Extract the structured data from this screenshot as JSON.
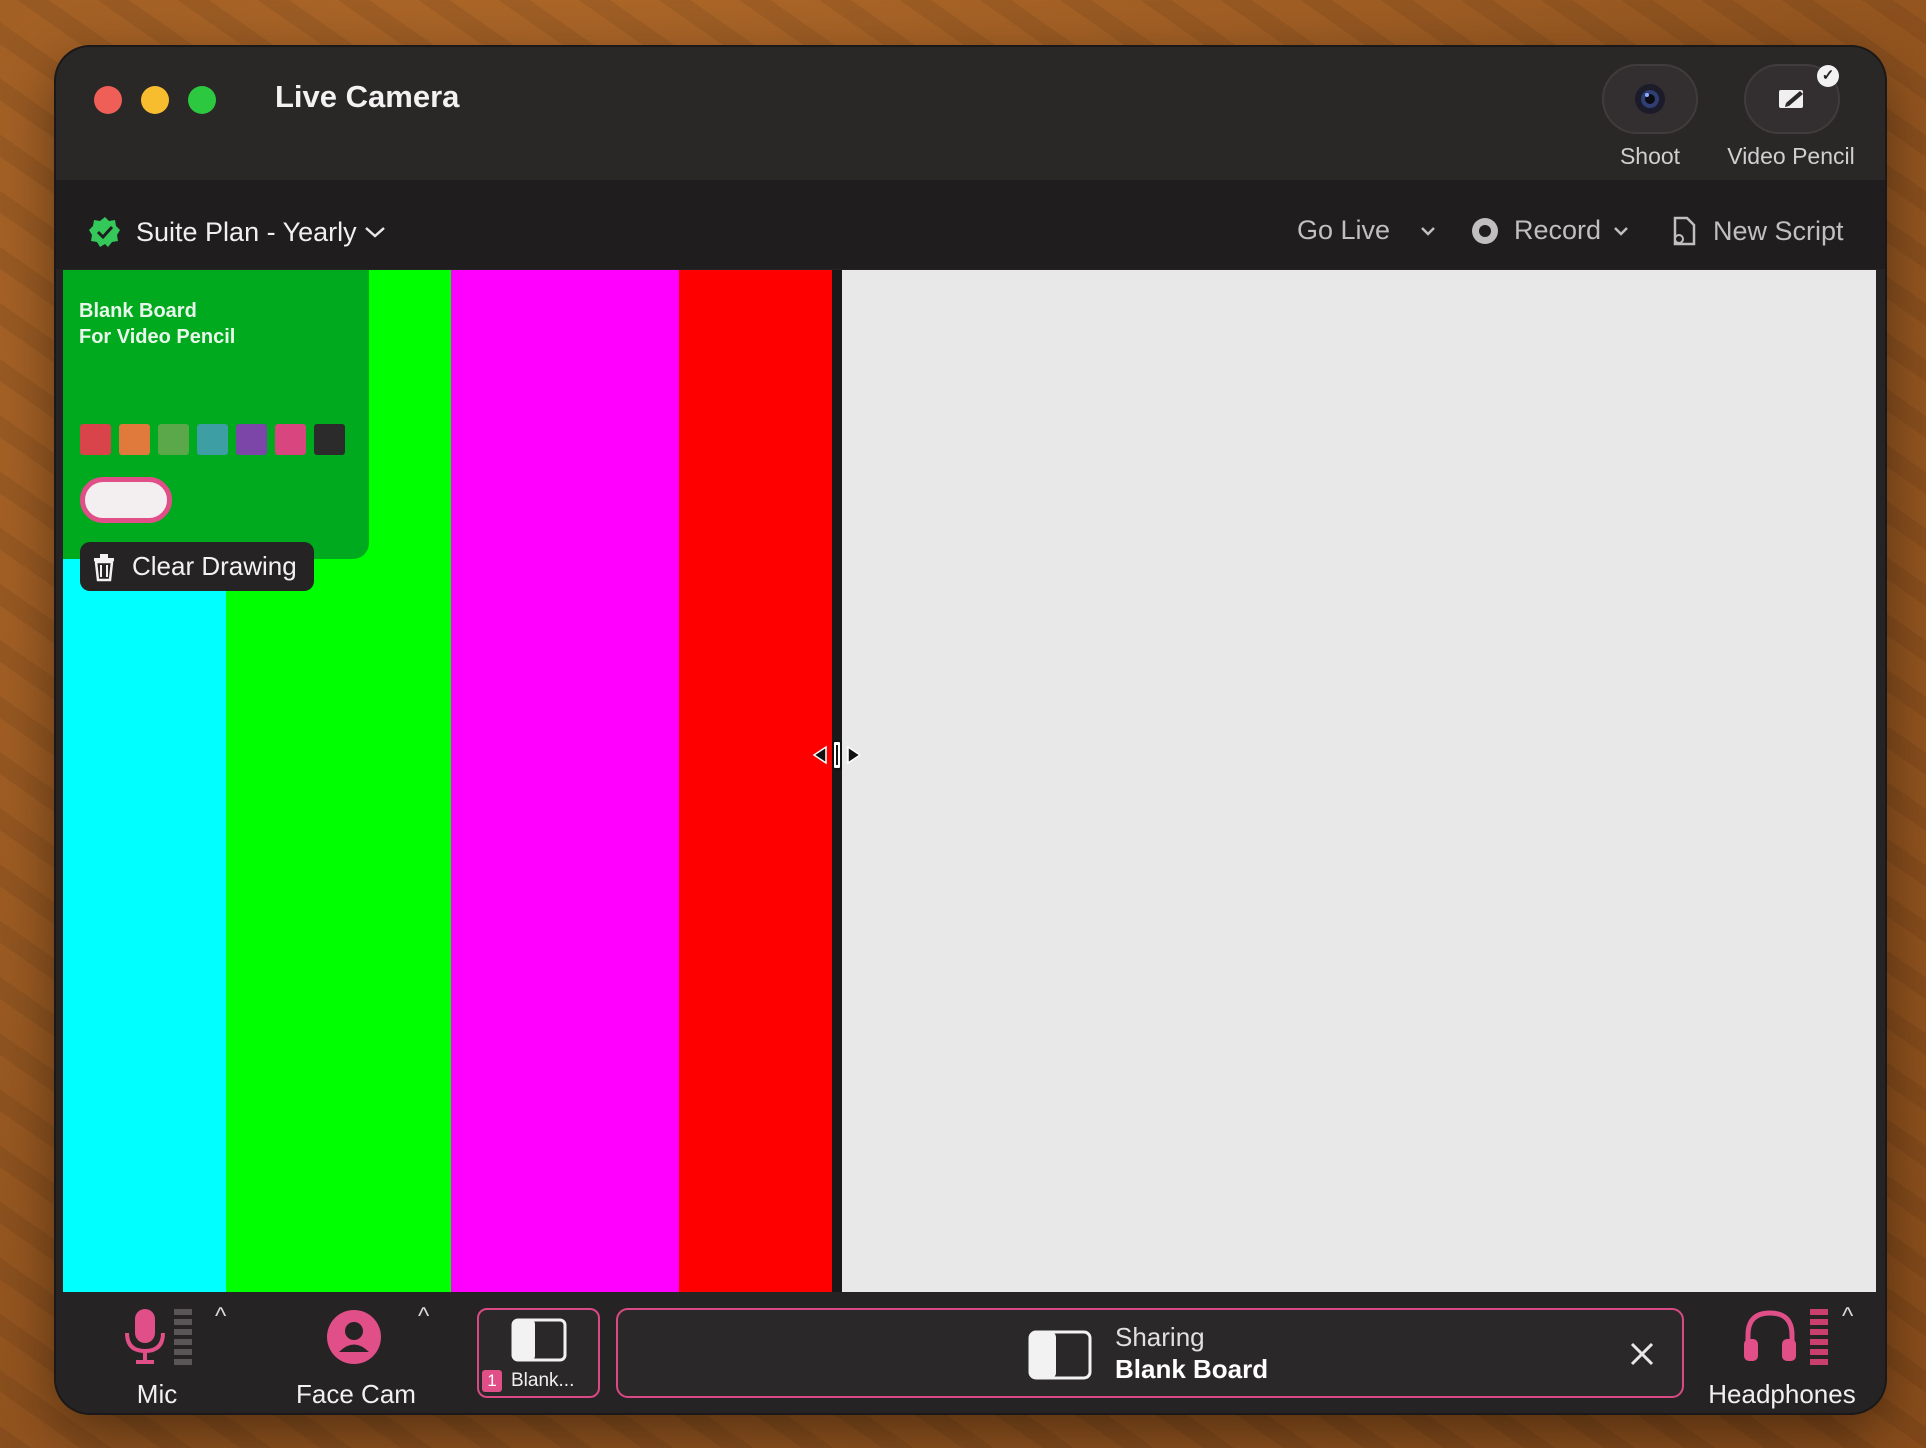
{
  "window": {
    "title": "Live Camera"
  },
  "titlebar_buttons": {
    "shoot": {
      "label": "Shoot",
      "icon": "camera-lens-icon"
    },
    "video_pencil": {
      "label": "Video Pencil",
      "icon": "pencil-screen-icon",
      "active": true
    }
  },
  "toolbar": {
    "plan": {
      "label": "Suite Plan - Yearly",
      "icon": "verified-badge-icon"
    },
    "go_live": {
      "label": "Go Live"
    },
    "record": {
      "label": "Record"
    },
    "new_script": {
      "label": "New Script"
    }
  },
  "stage": {
    "colors": [
      "#00ffff",
      "#00ff00",
      "#ff00ff",
      "#ff0000"
    ],
    "board_color": "#e8e8e8"
  },
  "pencil_panel": {
    "title_line1": "Blank Board",
    "title_line2": "For Video Pencil",
    "swatches": [
      "#d9434a",
      "#e07a3c",
      "#5aa84a",
      "#3d9ea3",
      "#7b46a8",
      "#d8457f",
      "#2b2b2b"
    ],
    "clear_label": "Clear Drawing"
  },
  "bottombar": {
    "mic": {
      "label": "Mic"
    },
    "face_cam": {
      "label": "Face Cam"
    },
    "scene": {
      "number": "1",
      "label": "Blank..."
    },
    "sharing": {
      "line1": "Sharing",
      "line2": "Blank Board"
    },
    "headphones": {
      "label": "Headphones"
    },
    "accent": "#e04f87"
  }
}
